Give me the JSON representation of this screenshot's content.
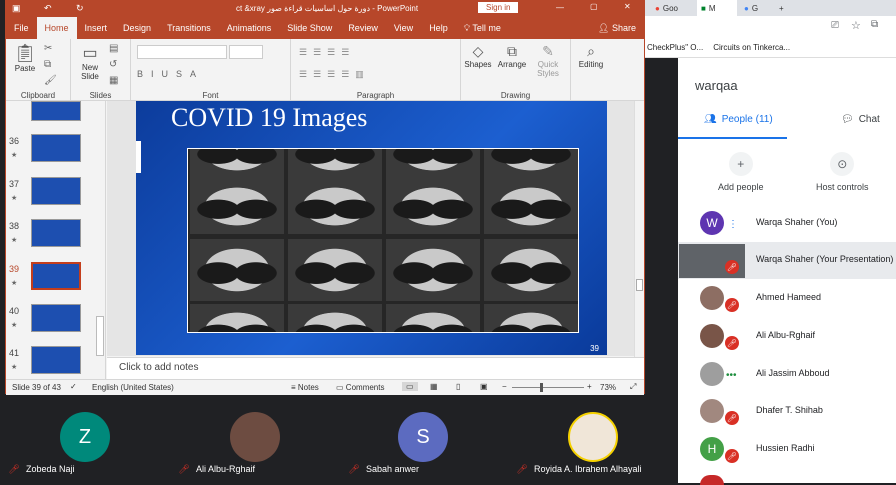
{
  "browser": {
    "tabs": [
      "Goo",
      "M",
      "G"
    ],
    "bookmarks": [
      "CheckPlus\" O...",
      "Circuits on Tinkerca..."
    ]
  },
  "ppt": {
    "title": "ct &xray دورة حول اساسيات قراءة صور - PowerPoint",
    "sign_in": "Sign in",
    "ribbon_tabs": [
      "File",
      "Home",
      "Insert",
      "Design",
      "Transitions",
      "Animations",
      "Slide Show",
      "Review",
      "View",
      "Help",
      "Tell me"
    ],
    "share": "Share",
    "groups": {
      "clipboard": "Clipboard",
      "slides": "Slides",
      "font": "Font",
      "paragraph": "Paragraph",
      "drawing": "Drawing"
    },
    "buttons": {
      "paste": "Paste",
      "new_slide": "New Slide",
      "shapes": "Shapes",
      "arrange": "Arrange",
      "quick_styles": "Quick Styles",
      "editing": "Editing"
    },
    "thumbnails": [
      "36",
      "37",
      "38",
      "39",
      "40",
      "41"
    ],
    "slide": {
      "title": "COVID 19 Images",
      "number": "39"
    },
    "notes_placeholder": "Click to add notes",
    "status": {
      "slide_info": "Slide 39 of 43",
      "language": "English (United States)",
      "notes": "Notes",
      "comments": "Comments",
      "zoom": "73%"
    }
  },
  "meet": {
    "meeting_name": "warqaa",
    "people_tab": "People (11)",
    "chat_tab": "Chat",
    "add_people": "Add people",
    "host_controls": "Host controls",
    "participants": [
      {
        "name": "Warqa Shaher (You)",
        "initial": "W",
        "color": "#5e35b1"
      },
      {
        "name": "Warqa Shaher (Your Presentation)",
        "initial": "",
        "color": "#5f6368"
      },
      {
        "name": "Ahmed Hameed",
        "initial": "",
        "color": "#8d6e63"
      },
      {
        "name": "Ali Albu-Rghaif",
        "initial": "",
        "color": "#795548"
      },
      {
        "name": "Ali Jassim Abboud",
        "initial": "",
        "color": "#9e9e9e"
      },
      {
        "name": "Dhafer T. Shihab",
        "initial": "",
        "color": "#a1887f"
      },
      {
        "name": "Hussien Radhi",
        "initial": "H",
        "color": "#43a047"
      }
    ]
  },
  "tiles": [
    {
      "name": "Zobeda Naji",
      "initial": "Z",
      "color": "#00897b"
    },
    {
      "name": "Ali Albu-Rghaif",
      "initial": "",
      "color": "#6d4c41"
    },
    {
      "name": "Sabah anwer",
      "initial": "S",
      "color": "#5c6bc0"
    },
    {
      "name": "Royida A. Ibrahem Alhayali",
      "initial": "",
      "color": "#f0e6d8"
    }
  ]
}
